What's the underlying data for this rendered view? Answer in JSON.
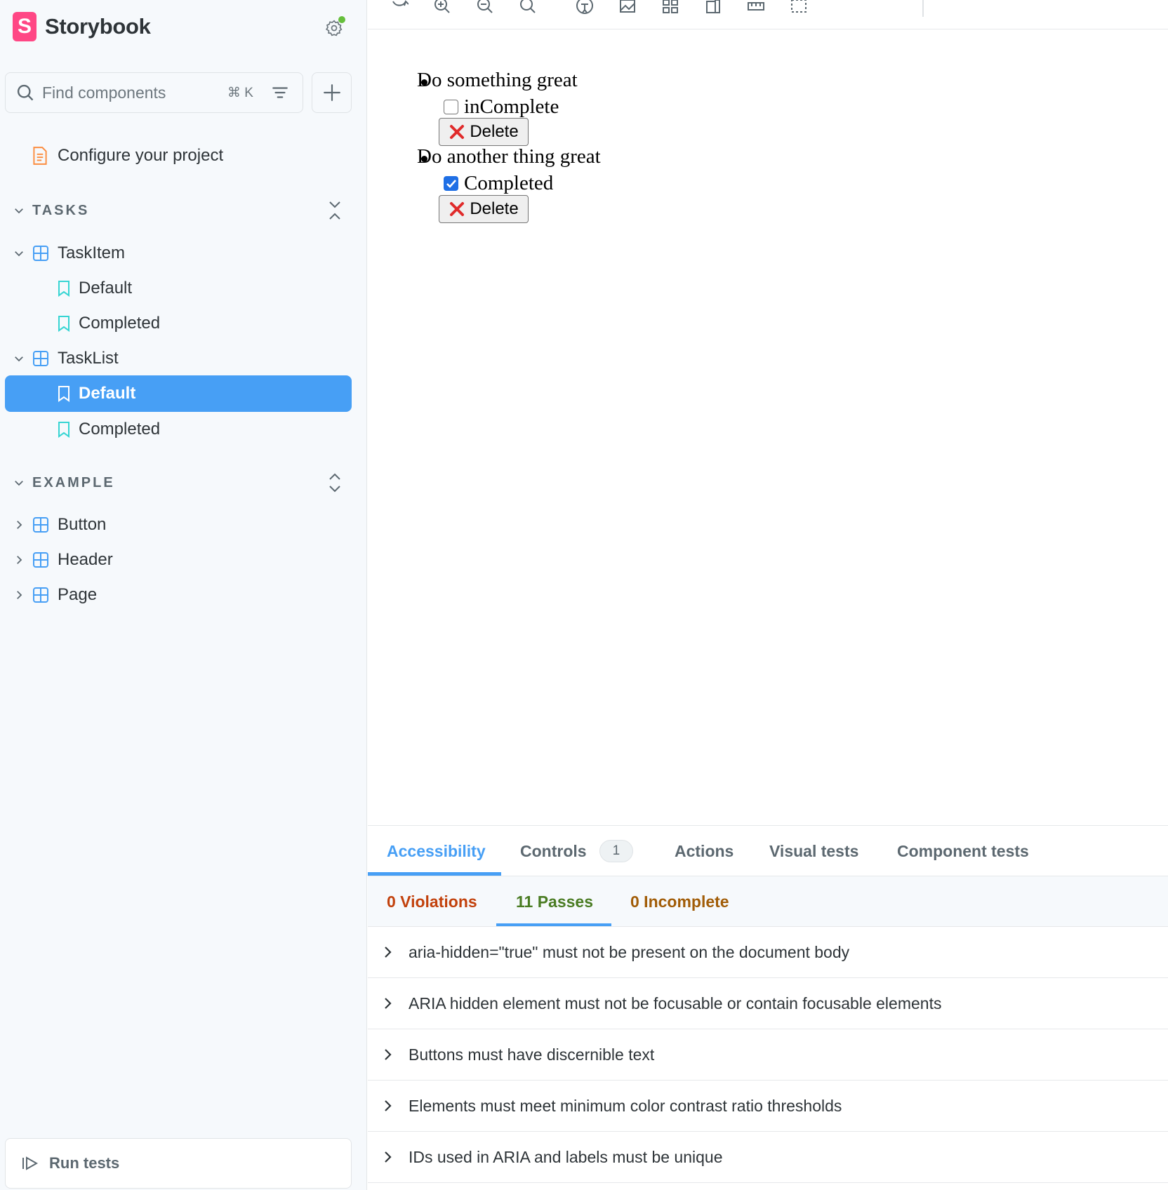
{
  "app": {
    "name": "Storybook"
  },
  "sidebar": {
    "search_placeholder": "Find components",
    "search_shortcut": "⌘ K",
    "configure_label": "Configure your project",
    "sections": [
      {
        "title": "TASKS",
        "components": [
          {
            "name": "TaskItem",
            "stories": [
              "Default",
              "Completed"
            ]
          },
          {
            "name": "TaskList",
            "stories": [
              "Default",
              "Completed"
            ]
          }
        ]
      },
      {
        "title": "EXAMPLE",
        "components": [
          {
            "name": "Button"
          },
          {
            "name": "Header"
          },
          {
            "name": "Page"
          }
        ]
      }
    ],
    "selected_story": "TaskList / Default",
    "run_tests_label": "Run tests"
  },
  "preview": {
    "tasks": [
      {
        "title": "Do something great",
        "status_label": "inComplete",
        "checked": false,
        "delete_label": "Delete"
      },
      {
        "title": "Do another thing great",
        "status_label": "Completed",
        "checked": true,
        "delete_label": "Delete"
      }
    ]
  },
  "panel": {
    "tabs": [
      {
        "label": "Accessibility",
        "active": true
      },
      {
        "label": "Controls",
        "badge": "1"
      },
      {
        "label": "Actions"
      },
      {
        "label": "Visual tests"
      },
      {
        "label": "Component tests"
      }
    ],
    "subtabs": [
      {
        "label": "0 Violations",
        "color": "#c2410c"
      },
      {
        "label": "11 Passes",
        "color": "#4a7c23"
      },
      {
        "label": "0 Incomplete",
        "color": "#a15c07"
      }
    ],
    "rules": [
      "aria-hidden=\"true\" must not be present on the document body",
      "ARIA hidden element must not be focusable or contain focusable elements",
      "Buttons must have discernible text",
      "Elements must meet minimum color contrast ratio thresholds",
      "IDs used in ARIA and labels must be unique"
    ]
  },
  "colors": {
    "accent": "#479ff5",
    "brand": "#ff4785",
    "status_dot": "#66bf3c",
    "component_icon": "#479ff5",
    "story_icon": "#37d5d3",
    "document_icon": "#fc8d3f"
  }
}
